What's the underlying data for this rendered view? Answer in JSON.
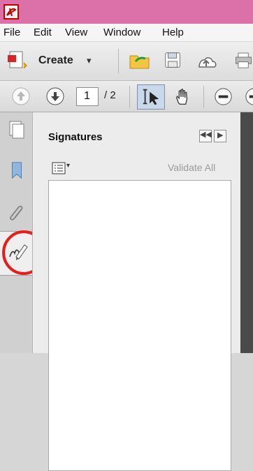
{
  "menu": [
    "File",
    "Edit",
    "View",
    "Window",
    "Help"
  ],
  "toolbar": {
    "create_label": "Create"
  },
  "navigation": {
    "current_page": "1",
    "page_total": "/ 2"
  },
  "panel": {
    "title": "Signatures",
    "validate_all": "Validate All"
  },
  "colors": {
    "titlebar": "#dc70a8",
    "annotation_circle": "#e3201b"
  }
}
